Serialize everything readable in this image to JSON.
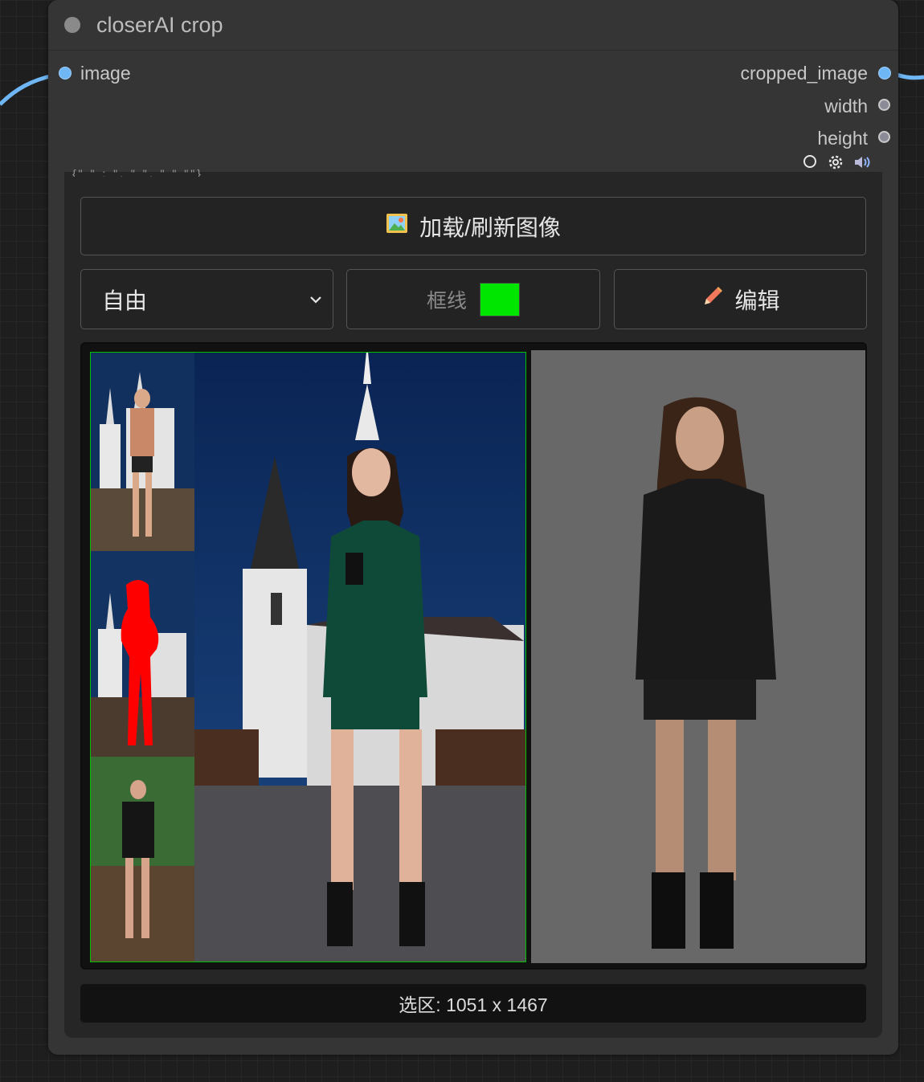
{
  "node": {
    "title": "closerAI crop",
    "input_slot": "image",
    "output_slots": [
      "cropped_image",
      "width",
      "height"
    ],
    "icons": [
      "circle-icon",
      "gear-icon",
      "speaker-icon"
    ]
  },
  "controls": {
    "load_label": "加载/刷新图像",
    "load_icon": "picture-icon",
    "ratio_selected": "自由",
    "border_label": "框线",
    "border_color": "#00e600",
    "edit_label": "编辑",
    "edit_icon": "pencil-icon"
  },
  "status": {
    "selection_text": "选区: 1051 x 1467"
  },
  "colors": {
    "node_bg": "#353535",
    "panel_bg": "#262626",
    "slot_blue": "#6fb6f5",
    "crop_border": "#00c000"
  }
}
